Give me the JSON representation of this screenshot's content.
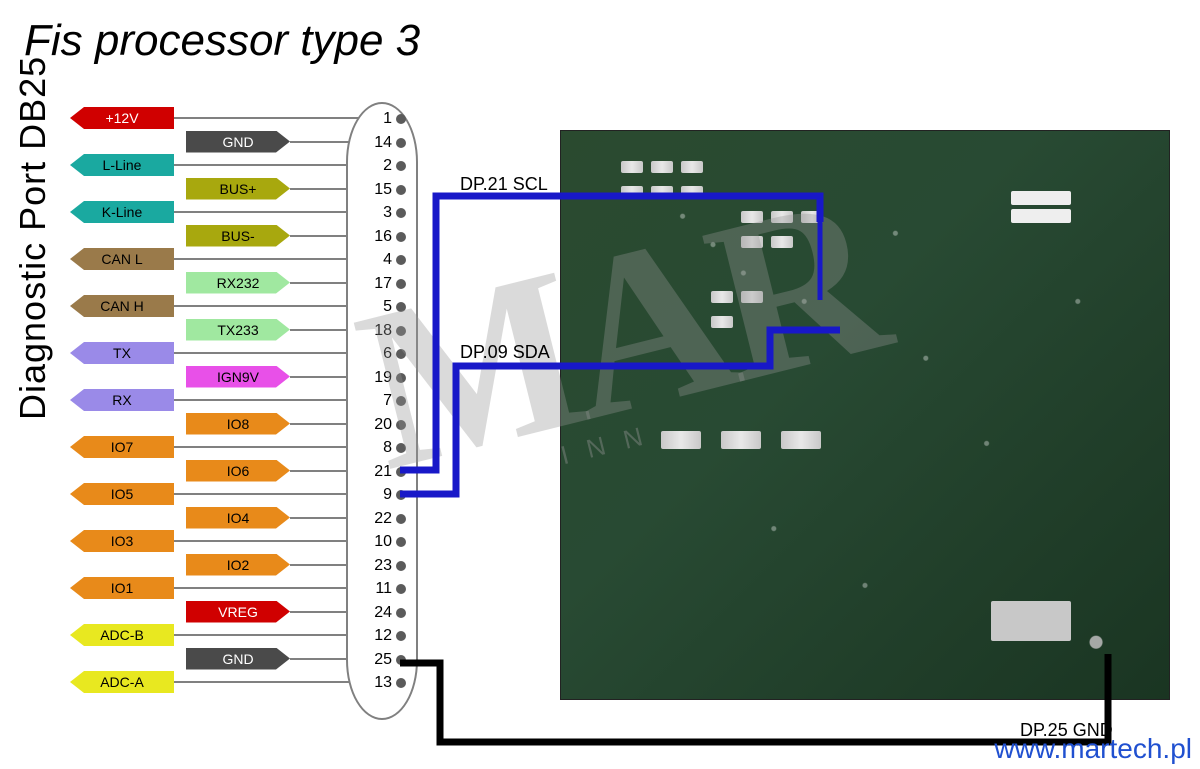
{
  "title": "Fis processor type 3",
  "port_label": "Diagnostic  Port  DB25",
  "colors": {
    "red": "#d00000",
    "gnd": "#4a4a4a",
    "teal": "#1aa9a0",
    "olive": "#a8a80e",
    "brown": "#9a7a4a",
    "ltgreen": "#a0e8a0",
    "violet": "#9a8ae8",
    "magenta": "#e850e8",
    "orange": "#e88a1a",
    "yellow": "#e8e820"
  },
  "pins_left": [
    {
      "n": 1,
      "label": "+12V",
      "colorKey": "red",
      "text": "white"
    },
    {
      "n": 2,
      "label": "L-Line",
      "colorKey": "teal",
      "text": "black"
    },
    {
      "n": 3,
      "label": "K-Line",
      "colorKey": "teal",
      "text": "black"
    },
    {
      "n": 4,
      "label": "CAN  L",
      "colorKey": "brown",
      "text": "black"
    },
    {
      "n": 5,
      "label": "CAN  H",
      "colorKey": "brown",
      "text": "black"
    },
    {
      "n": 6,
      "label": "TX",
      "colorKey": "violet",
      "text": "black"
    },
    {
      "n": 7,
      "label": "RX",
      "colorKey": "violet",
      "text": "black"
    },
    {
      "n": 8,
      "label": "IO7",
      "colorKey": "orange",
      "text": "black"
    },
    {
      "n": 9,
      "label": "IO5",
      "colorKey": "orange",
      "text": "black"
    },
    {
      "n": 10,
      "label": "IO3",
      "colorKey": "orange",
      "text": "black"
    },
    {
      "n": 11,
      "label": "IO1",
      "colorKey": "orange",
      "text": "black"
    },
    {
      "n": 12,
      "label": "ADC-B",
      "colorKey": "yellow",
      "text": "black"
    },
    {
      "n": 13,
      "label": "ADC-A",
      "colorKey": "yellow",
      "text": "black"
    }
  ],
  "pins_right": [
    {
      "n": 14,
      "label": "GND",
      "colorKey": "gnd",
      "text": "white"
    },
    {
      "n": 15,
      "label": "BUS+",
      "colorKey": "olive",
      "text": "black"
    },
    {
      "n": 16,
      "label": "BUS-",
      "colorKey": "olive",
      "text": "black"
    },
    {
      "n": 17,
      "label": "RX232",
      "colorKey": "ltgreen",
      "text": "black"
    },
    {
      "n": 18,
      "label": "TX233",
      "colorKey": "ltgreen",
      "text": "black"
    },
    {
      "n": 19,
      "label": "IGN9V",
      "colorKey": "magenta",
      "text": "black"
    },
    {
      "n": 20,
      "label": "IO8",
      "colorKey": "orange",
      "text": "black"
    },
    {
      "n": 21,
      "label": "IO6",
      "colorKey": "orange",
      "text": "black"
    },
    {
      "n": 22,
      "label": "IO4",
      "colorKey": "orange",
      "text": "black"
    },
    {
      "n": 23,
      "label": "IO2",
      "colorKey": "orange",
      "text": "black"
    },
    {
      "n": 24,
      "label": "VREG",
      "colorKey": "red",
      "text": "white"
    },
    {
      "n": 25,
      "label": "GND",
      "colorKey": "gnd",
      "text": "white"
    }
  ],
  "trace_labels": {
    "scl": "DP.21  SCL",
    "sda": "DP.09  SDA",
    "gnd": "DP.25  GND"
  },
  "watermark": "MAR",
  "watermark_sub": "I N N",
  "url": "www.martech.pl"
}
